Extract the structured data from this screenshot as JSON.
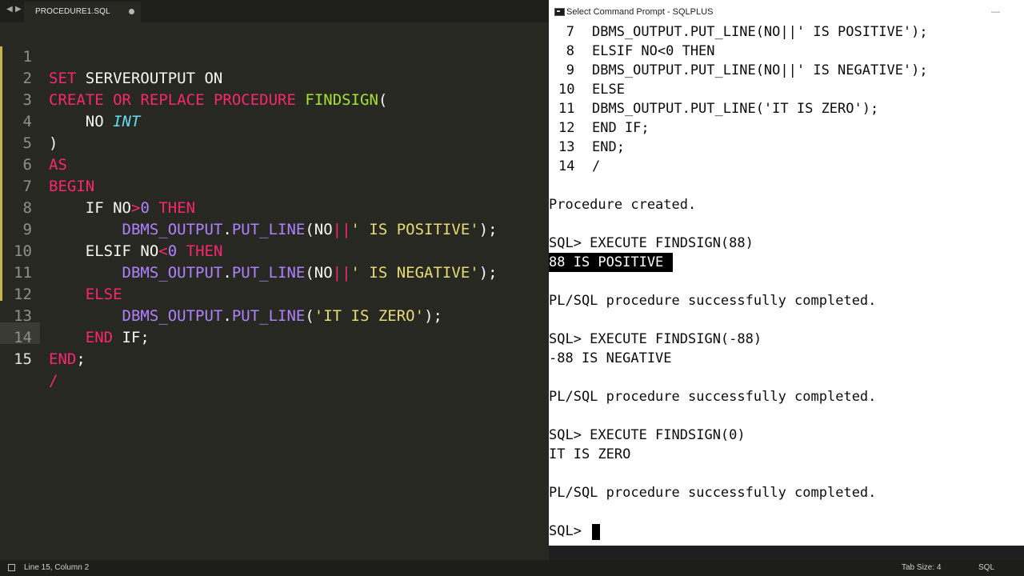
{
  "editor": {
    "tab_title": "PROCEDURE1.SQL",
    "nav_back": "◀",
    "nav_forward": "▶",
    "current_line_number": 15,
    "line_numbers": [
      "1",
      "2",
      "3",
      "4",
      "5",
      "6",
      "7",
      "8",
      "9",
      "10",
      "11",
      "12",
      "13",
      "14",
      "15"
    ],
    "tokens": {
      "l1_set": "SET",
      "l1_rest": " SERVEROUTPUT ON",
      "l2_create": "CREATE",
      "l2_or": "OR",
      "l2_replace": "REPLACE",
      "l2_procedure": "PROCEDURE",
      "l2_name": "FINDSIGN",
      "l2_paren": "(",
      "l3_no": "NO ",
      "l3_int": "INT",
      "l4_close": ")",
      "l5_as": "AS",
      "l6_begin": "BEGIN",
      "l7_if": "IF",
      "l7_no": " NO",
      "l7_op": ">",
      "l7_zero": "0",
      "l7_then": "THEN",
      "l8_dbms": "DBMS_OUTPUT",
      "l8_dot": ".",
      "l8_put": "PUT_LINE",
      "l8_open": "(NO",
      "l8_concat": "||",
      "l8_str": "' IS POSITIVE'",
      "l8_end": ");",
      "l9_elsif": "ELSIF",
      "l9_no": " NO",
      "l9_op": "<",
      "l9_zero": "0",
      "l9_then": "THEN",
      "l10_dbms": "DBMS_OUTPUT",
      "l10_dot": ".",
      "l10_put": "PUT_LINE",
      "l10_open": "(NO",
      "l10_concat": "||",
      "l10_str": "' IS NEGATIVE'",
      "l10_end": ");",
      "l11_else": "ELSE",
      "l12_dbms": "DBMS_OUTPUT",
      "l12_dot": ".",
      "l12_put": "PUT_LINE",
      "l12_open": "(",
      "l12_str": "'IT IS ZERO'",
      "l12_end": ");",
      "l13_end": "END",
      "l13_if": " IF;",
      "l14_end": "END",
      "l14_semi": ";",
      "l15_slash": "/"
    }
  },
  "console": {
    "title": "Select Command Prompt - SQLPLUS",
    "minimize": "—",
    "listing": [
      {
        "num": "7",
        "code": "DBMS_OUTPUT.PUT_LINE(NO||' IS POSITIVE');"
      },
      {
        "num": "8",
        "code": "ELSIF NO<0 THEN"
      },
      {
        "num": "9",
        "code": "DBMS_OUTPUT.PUT_LINE(NO||' IS NEGATIVE');"
      },
      {
        "num": "10",
        "code": "ELSE"
      },
      {
        "num": "11",
        "code": "DBMS_OUTPUT.PUT_LINE('IT IS ZERO');"
      },
      {
        "num": "12",
        "code": "END IF;"
      },
      {
        "num": "13",
        "code": "END;"
      },
      {
        "num": "14",
        "code": "/"
      }
    ],
    "procedure_created": "Procedure created.",
    "exec1_cmd": "SQL> EXECUTE FINDSIGN(88)",
    "exec1_out": "88 IS POSITIVE",
    "exec1_done": "PL/SQL procedure successfully completed.",
    "exec2_cmd": "SQL> EXECUTE FINDSIGN(-88)",
    "exec2_out": "-88 IS NEGATIVE",
    "exec2_done": "PL/SQL procedure successfully completed.",
    "exec3_cmd": "SQL> EXECUTE FINDSIGN(0)",
    "exec3_out": "IT IS ZERO",
    "exec3_done": "PL/SQL procedure successfully completed.",
    "prompt": "SQL> "
  },
  "statusbar": {
    "position": "Line 15, Column 2",
    "tab_size": "Tab Size: 4",
    "syntax": "SQL"
  },
  "colors": {
    "keyword": "#f92672",
    "function": "#a6e22e",
    "type": "#66d9ef",
    "string": "#e6db74",
    "builtin": "#ae81ff",
    "editor_bg": "#272822"
  }
}
